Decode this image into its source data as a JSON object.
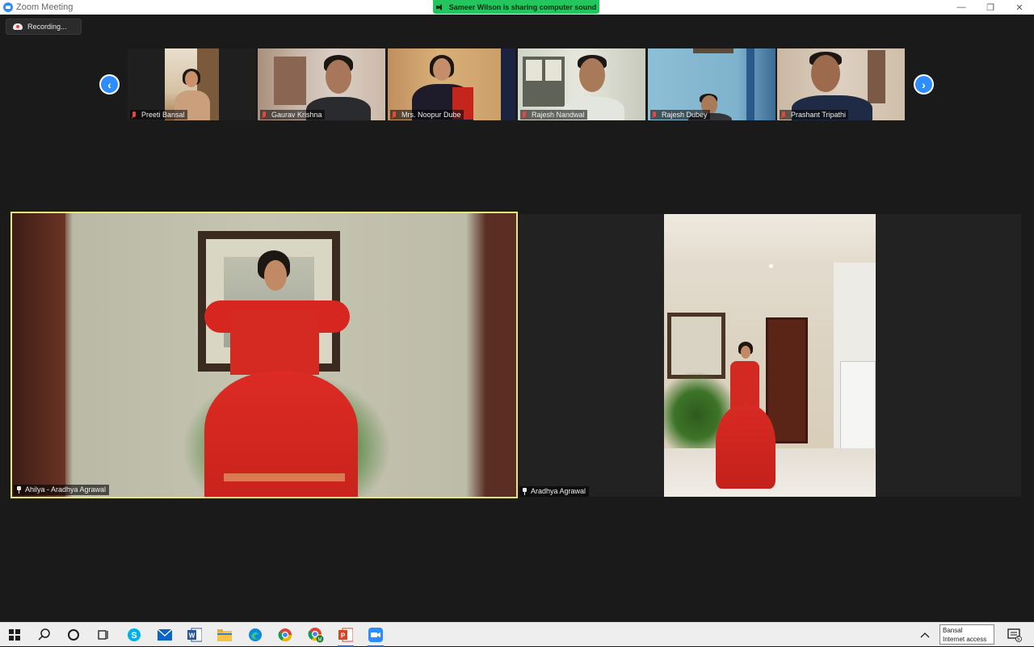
{
  "window": {
    "title": "Zoom Meeting",
    "minimize_glyph": "—",
    "restore_glyph": "❐",
    "close_glyph": "✕"
  },
  "share_banner": "Sameer Wilson is sharing computer sound",
  "recording_label": "Recording...",
  "nav": {
    "prev_glyph": "‹",
    "next_glyph": "›"
  },
  "participants": [
    {
      "name": "Preeti Bansal",
      "muted": true
    },
    {
      "name": "Gaurav Krishna",
      "muted": true
    },
    {
      "name": "Mrs. Noopur Dube",
      "muted": true
    },
    {
      "name": "Rajesh Nandwal",
      "muted": true
    },
    {
      "name": "Rajesh Dubey",
      "muted": true
    },
    {
      "name": "Prashant Tripathi",
      "muted": true
    }
  ],
  "main_tiles": [
    {
      "name": "Ahilya - Aradhya Agrawal",
      "active_speaker": true,
      "pinned": true
    },
    {
      "name": "Aradhya Agrawal",
      "active_speaker": false,
      "pinned": true
    }
  ],
  "taskbar": {
    "apps": [
      "windows-start",
      "search",
      "cortana",
      "task-view",
      "skype",
      "mail",
      "word",
      "file-explorer",
      "edge",
      "chrome",
      "chrome-profile",
      "powerpoint",
      "zoom"
    ],
    "tooltip_line1": "Bansal",
    "tooltip_line2": "Internet access",
    "notification_count": "5"
  },
  "colors": {
    "zoom_blue": "#2d8cff",
    "active_border": "#e9e77a",
    "banner_green": "#22c55e",
    "muted_red": "#e5483e"
  }
}
